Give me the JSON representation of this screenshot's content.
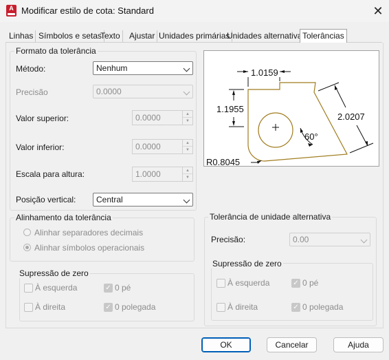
{
  "window": {
    "title": "Modificar estilo de cota: Standard"
  },
  "tabs": [
    {
      "label": "Linhas"
    },
    {
      "label": "Símbolos e setas"
    },
    {
      "label": "Texto"
    },
    {
      "label": "Ajustar"
    },
    {
      "label": "Unidades primárias"
    },
    {
      "label": "Unidades alternativas"
    },
    {
      "label": "Tolerâncias"
    }
  ],
  "tolerance_format": {
    "legend": "Formato da tolerância",
    "method": {
      "label": "Método:",
      "value": "Nenhum"
    },
    "precision": {
      "label": "Precisão",
      "value": "0.0000"
    },
    "upper": {
      "label": "Valor superior:",
      "value": "0.0000"
    },
    "lower": {
      "label": "Valor inferior:",
      "value": "0.0000"
    },
    "height_scale": {
      "label": "Escala para altura:",
      "value": "1.0000"
    },
    "vertical_position": {
      "label": "Posição vertical:",
      "value": "Central"
    }
  },
  "alignment": {
    "legend": "Alinhamento da tolerância",
    "opt_decimal": "Alinhar separadores decimais",
    "opt_operational": "Alinhar símbolos operacionais"
  },
  "zero_left": {
    "legend": "Supressão de zero",
    "leading": "À esquerda",
    "zero_feet": "0 pé",
    "trailing": "À direita",
    "zero_inches": "0 polegada"
  },
  "alt_tolerance": {
    "legend": "Tolerância de unidade alternativa",
    "precision_label": "Precisão:",
    "precision_value": "0.00"
  },
  "zero_right": {
    "legend": "Supressão de zero",
    "leading": "À esquerda",
    "zero_feet": "0 pé",
    "trailing": "À direita",
    "zero_inches": "0 polegada"
  },
  "preview": {
    "dim_top": "1.0159",
    "dim_left": "1.1955",
    "dim_right": "2.0207",
    "angle": "60°",
    "radius": "R0.8045"
  },
  "buttons": {
    "ok": "OK",
    "cancel": "Cancelar",
    "help": "Ajuda"
  }
}
